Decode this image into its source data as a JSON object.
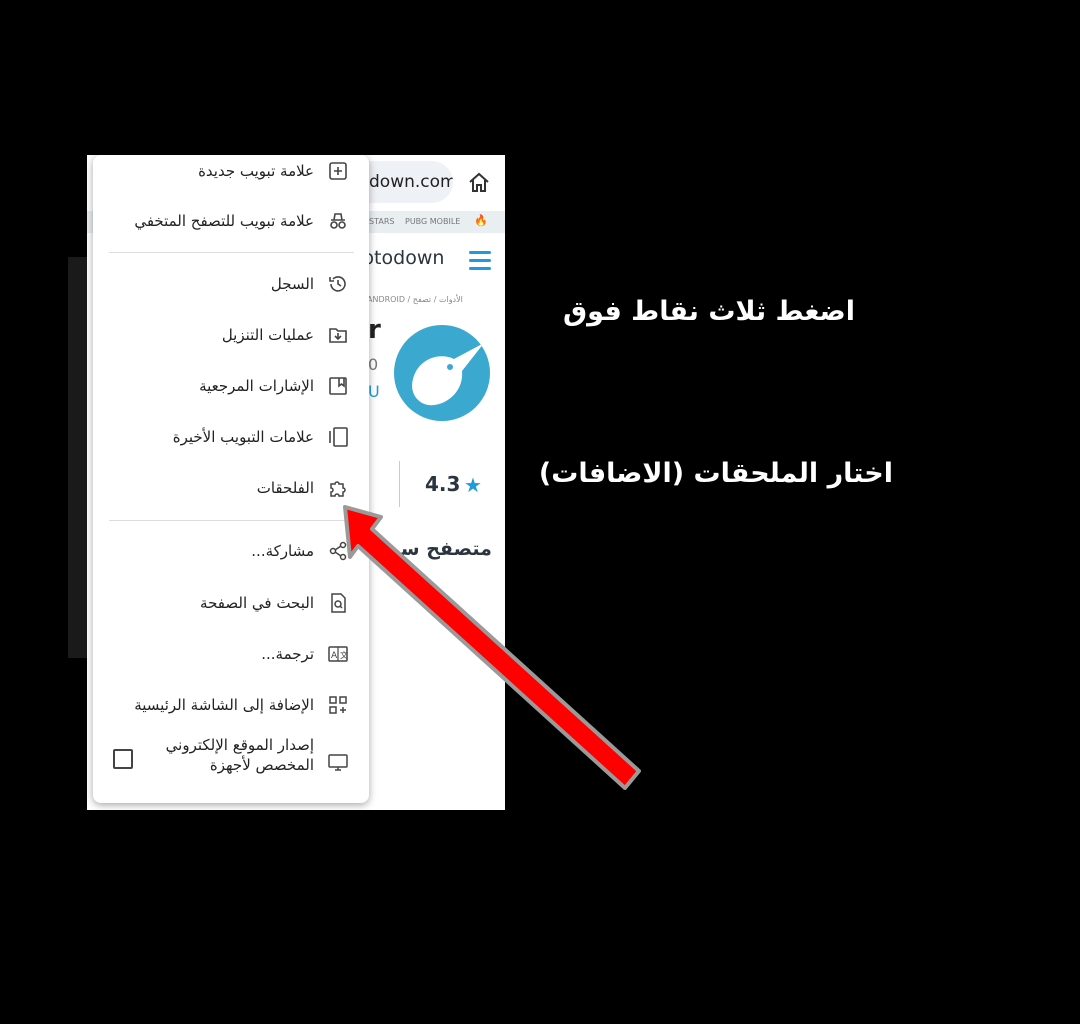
{
  "browser": {
    "url_text": "down.com",
    "quick_links": [
      "STARS",
      "PUBG MOBILE"
    ],
    "site_logo": "ptodown",
    "breadcrumb": "ANDROID / الأدوات / تصفح",
    "app_title_fragment": "r",
    "app_sub1": "0",
    "app_sub2": "U",
    "rating": "4.3",
    "app_heading_fragment": "متصفح سريع"
  },
  "menu": {
    "items": [
      {
        "label": "علامة تبويب جديدة",
        "icon": "plus-box-icon"
      },
      {
        "label": "علامة تبويب للتصفح المتخفي",
        "icon": "incognito-icon"
      },
      {
        "label": "السجل",
        "icon": "history-icon"
      },
      {
        "label": "عمليات التنزيل",
        "icon": "download-folder-icon"
      },
      {
        "label": "الإشارات المرجعية",
        "icon": "bookmark-icon"
      },
      {
        "label": "علامات التبويب الأخيرة",
        "icon": "recent-tabs-icon"
      },
      {
        "label": "الفلحقات",
        "icon": "puzzle-icon"
      },
      {
        "label": "مشاركة...",
        "icon": "share-icon"
      },
      {
        "label": "البحث في الصفحة",
        "icon": "find-in-page-icon"
      },
      {
        "label": "ترجمة...",
        "icon": "translate-icon"
      },
      {
        "label": "الإضافة إلى الشاشة الرئيسية",
        "icon": "add-to-home-icon"
      },
      {
        "label": "إصدار الموقع الإلكتروني المخصص لأجهزة",
        "icon": "desktop-icon"
      }
    ]
  },
  "annotations": {
    "step1": "اضغط ثلاث نقاط فوق",
    "step2": "اختار الملحقات (الاضافات)",
    "arrow_color": "#ff0000"
  },
  "colors": {
    "accent": "#1f9bd9",
    "background": "#000000"
  }
}
